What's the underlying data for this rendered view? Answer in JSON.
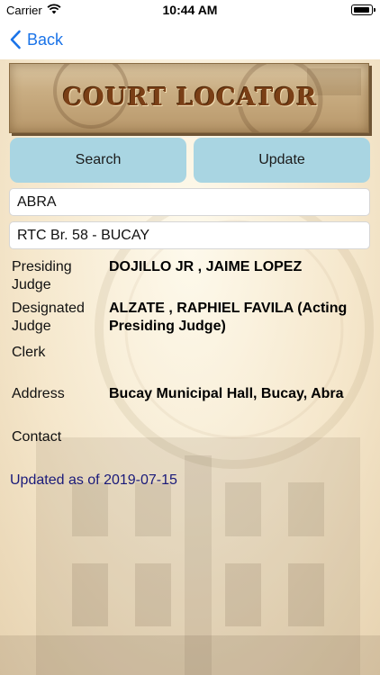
{
  "status_bar": {
    "carrier": "Carrier",
    "time": "10:44 AM"
  },
  "nav": {
    "back_label": "Back"
  },
  "banner": {
    "title": "COURT LOCATOR"
  },
  "buttons": {
    "search_label": "Search",
    "update_label": "Update"
  },
  "fields": {
    "region": "ABRA",
    "court": "RTC Br. 58 - BUCAY"
  },
  "details": {
    "presiding_judge_label": "Presiding Judge",
    "presiding_judge_value": "DOJILLO JR ,  JAIME LOPEZ",
    "designated_judge_label": "Designated Judge",
    "designated_judge_value": "ALZATE ,  RAPHIEL FAVILA (Acting Presiding Judge)",
    "clerk_label": "Clerk",
    "clerk_value": "",
    "address_label": "Address",
    "address_value": "Bucay Municipal Hall, Bucay, Abra",
    "contact_label": "Contact",
    "contact_value": ""
  },
  "updated_text": "Updated as of 2019-07-15",
  "colors": {
    "accent": "#1a73e8",
    "button_bg": "#a9d5e2",
    "banner_text": "#7a3f16",
    "updated_text": "#1a1a7a"
  },
  "icons": {
    "wifi": "wifi-icon",
    "battery": "battery-icon",
    "back": "chevron-left-icon"
  }
}
